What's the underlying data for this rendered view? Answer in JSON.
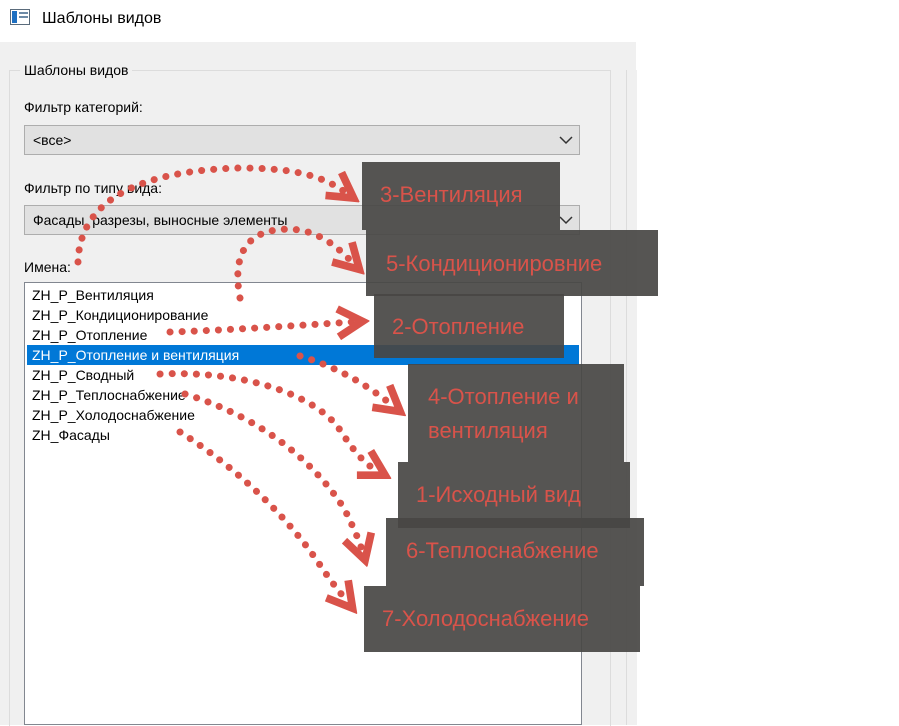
{
  "window": {
    "title": "Шаблоны видов",
    "icon": "window-app-icon"
  },
  "group": {
    "title": "Шаблоны видов"
  },
  "category_filter": {
    "label": "Фильтр категорий:",
    "value": "<все>"
  },
  "view_type_filter": {
    "label": "Фильтр по типу вида:",
    "value": "Фасады, разрезы, выносные элементы"
  },
  "names": {
    "label": "Имена:",
    "items": [
      "ZH_P_Вентиляция",
      "ZH_P_Кондиционирование",
      "ZH_P_Отопление",
      "ZH_P_Отопление и вентиляция",
      "ZH_P_Сводный",
      "ZH_P_Теплоснабжение",
      "ZH_P_Холодоснабжение",
      "ZH_Фасады"
    ],
    "selected_index": 3
  },
  "annotations": [
    {
      "line1": "3-Вентиляция",
      "line2": ""
    },
    {
      "line1": "5-Кондиционировние",
      "line2": ""
    },
    {
      "line1": "2-Отопление",
      "line2": ""
    },
    {
      "line1": "4-Отопление и",
      "line2": "вентиляция"
    },
    {
      "line1": "1-Исходный вид",
      "line2": ""
    },
    {
      "line1": "6-Теплоснабжение",
      "line2": ""
    },
    {
      "line1": "7-Холодоснабжение",
      "line2": ""
    }
  ],
  "colors": {
    "selection": "#0078d7",
    "annotation_bg": "#484644",
    "annotation_text": "#d9534a",
    "arrow": "#d9534a"
  }
}
